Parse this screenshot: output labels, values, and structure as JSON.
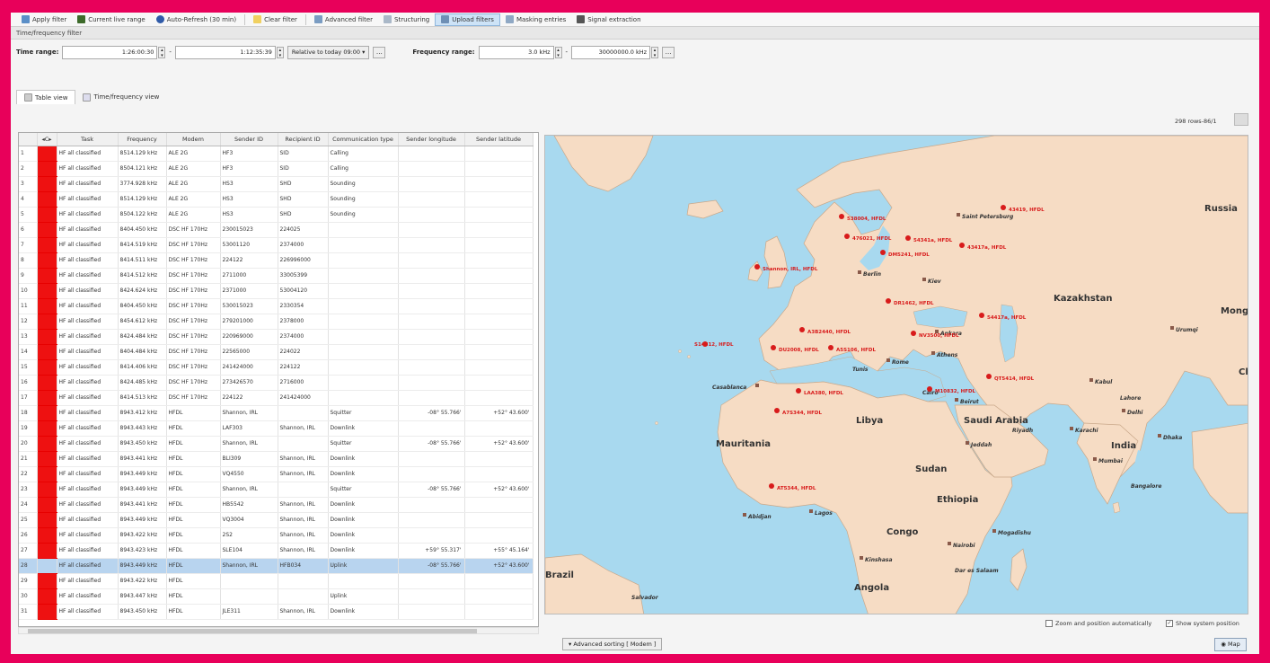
{
  "toolbar": {
    "buttons": [
      {
        "label": "Apply filter",
        "color": "#5b8fc7"
      },
      {
        "label": "Current live range",
        "color": "#3d6a2a"
      },
      {
        "label": "Auto-Refresh (30 min)",
        "color": "#2f5aa8"
      },
      {
        "label": "Clear filter",
        "color": "#f0d060"
      },
      {
        "label": "Advanced filter",
        "color": "#7a9cc2"
      },
      {
        "label": "Structuring",
        "color": "#aab8c8"
      },
      {
        "label": "Upload filters",
        "color": "#6e8fb5"
      },
      {
        "label": "Masking entries",
        "color": "#8fa8c4"
      },
      {
        "label": "Signal extraction",
        "color": "#555"
      }
    ]
  },
  "section_title": "Time/frequency filter",
  "filters": {
    "time_label": "Time range:",
    "time_from": "1:26:00:30",
    "time_to": "1:12:35:39",
    "time_relative": "Relative to today 09:00",
    "freq_label": "Frequency range:",
    "freq_from": "3.0 kHz",
    "freq_to": "30000000.0 kHz"
  },
  "tabs": [
    "Table view",
    "Time/frequency view"
  ],
  "row_count": "298 rows-86/1",
  "columns": [
    "Task",
    "Frequency",
    "Modem",
    "Sender ID",
    "Recipient ID",
    "Communication type",
    "Sender longitude",
    "Sender latitude"
  ],
  "rows": [
    {
      "n": "1",
      "task": "HF all classified",
      "freq": "8514.129 kHz",
      "modem": "ALE 2G",
      "sender": "HF3",
      "recipient": "SID",
      "comm": "Calling",
      "lon": "",
      "lat": ""
    },
    {
      "n": "2",
      "task": "HF all classified",
      "freq": "8504.121 kHz",
      "modem": "ALE 2G",
      "sender": "HF3",
      "recipient": "SID",
      "comm": "Calling",
      "lon": "",
      "lat": ""
    },
    {
      "n": "3",
      "task": "HF all classified",
      "freq": "3774.928 kHz",
      "modem": "ALE 2G",
      "sender": "HS3",
      "recipient": "SHD",
      "comm": "Sounding",
      "lon": "",
      "lat": ""
    },
    {
      "n": "4",
      "task": "HF all classified",
      "freq": "8514.129 kHz",
      "modem": "ALE 2G",
      "sender": "HS3",
      "recipient": "SHD",
      "comm": "Sounding",
      "lon": "",
      "lat": ""
    },
    {
      "n": "5",
      "task": "HF all classified",
      "freq": "8504.122 kHz",
      "modem": "ALE 2G",
      "sender": "HS3",
      "recipient": "SHD",
      "comm": "Sounding",
      "lon": "",
      "lat": ""
    },
    {
      "n": "6",
      "task": "HF all classified",
      "freq": "8404.450 kHz",
      "modem": "DSC HF 170Hz",
      "sender": "230015023",
      "recipient": "224025",
      "comm": "",
      "lon": "",
      "lat": ""
    },
    {
      "n": "7",
      "task": "HF all classified",
      "freq": "8414.519 kHz",
      "modem": "DSC HF 170Hz",
      "sender": "53001120",
      "recipient": "2374000",
      "comm": "",
      "lon": "",
      "lat": ""
    },
    {
      "n": "8",
      "task": "HF all classified",
      "freq": "8414.511 kHz",
      "modem": "DSC HF 170Hz",
      "sender": "224122",
      "recipient": "226996000",
      "comm": "",
      "lon": "",
      "lat": ""
    },
    {
      "n": "9",
      "task": "HF all classified",
      "freq": "8414.512 kHz",
      "modem": "DSC HF 170Hz",
      "sender": "2711000",
      "recipient": "33005399",
      "comm": "",
      "lon": "",
      "lat": ""
    },
    {
      "n": "10",
      "task": "HF all classified",
      "freq": "8424.624 kHz",
      "modem": "DSC HF 170Hz",
      "sender": "2371000",
      "recipient": "53004120",
      "comm": "",
      "lon": "",
      "lat": ""
    },
    {
      "n": "11",
      "task": "HF all classified",
      "freq": "8404.450 kHz",
      "modem": "DSC HF 170Hz",
      "sender": "530015023",
      "recipient": "2330354",
      "comm": "",
      "lon": "",
      "lat": ""
    },
    {
      "n": "12",
      "task": "HF all classified",
      "freq": "8454.612 kHz",
      "modem": "DSC HF 170Hz",
      "sender": "279201000",
      "recipient": "2378000",
      "comm": "",
      "lon": "",
      "lat": ""
    },
    {
      "n": "13",
      "task": "HF all classified",
      "freq": "8424.484 kHz",
      "modem": "DSC HF 170Hz",
      "sender": "220969000",
      "recipient": "2374000",
      "comm": "",
      "lon": "",
      "lat": ""
    },
    {
      "n": "14",
      "task": "HF all classified",
      "freq": "8404.484 kHz",
      "modem": "DSC HF 170Hz",
      "sender": "22565000",
      "recipient": "224022",
      "comm": "",
      "lon": "",
      "lat": ""
    },
    {
      "n": "15",
      "task": "HF all classified",
      "freq": "8414.406 kHz",
      "modem": "DSC HF 170Hz",
      "sender": "241424000",
      "recipient": "224122",
      "comm": "",
      "lon": "",
      "lat": ""
    },
    {
      "n": "16",
      "task": "HF all classified",
      "freq": "8424.485 kHz",
      "modem": "DSC HF 170Hz",
      "sender": "273426570",
      "recipient": "2716000",
      "comm": "",
      "lon": "",
      "lat": ""
    },
    {
      "n": "17",
      "task": "HF all classified",
      "freq": "8414.513 kHz",
      "modem": "DSC HF 170Hz",
      "sender": "224122",
      "recipient": "241424000",
      "comm": "",
      "lon": "",
      "lat": ""
    },
    {
      "n": "18",
      "task": "HF all classified",
      "freq": "8943.412 kHz",
      "modem": "HFDL",
      "sender": "Shannon, IRL",
      "recipient": "",
      "comm": "Squitter",
      "lon": "-08° 55.766'",
      "lat": "+52° 43.600'"
    },
    {
      "n": "19",
      "task": "HF all classified",
      "freq": "8943.443 kHz",
      "modem": "HFDL",
      "sender": "LAF303",
      "recipient": "Shannon, IRL",
      "comm": "Downlink",
      "lon": "",
      "lat": ""
    },
    {
      "n": "20",
      "task": "HF all classified",
      "freq": "8943.450 kHz",
      "modem": "HFDL",
      "sender": "Shannon, IRL",
      "recipient": "",
      "comm": "Squitter",
      "lon": "-08° 55.766'",
      "lat": "+52° 43.600'"
    },
    {
      "n": "21",
      "task": "HF all classified",
      "freq": "8943.441 kHz",
      "modem": "HFDL",
      "sender": "BLI309",
      "recipient": "Shannon, IRL",
      "comm": "Downlink",
      "lon": "",
      "lat": ""
    },
    {
      "n": "22",
      "task": "HF all classified",
      "freq": "8943.449 kHz",
      "modem": "HFDL",
      "sender": "VQ4550",
      "recipient": "Shannon, IRL",
      "comm": "Downlink",
      "lon": "",
      "lat": ""
    },
    {
      "n": "23",
      "task": "HF all classified",
      "freq": "8943.449 kHz",
      "modem": "HFDL",
      "sender": "Shannon, IRL",
      "recipient": "",
      "comm": "Squitter",
      "lon": "-08° 55.766'",
      "lat": "+52° 43.600'"
    },
    {
      "n": "24",
      "task": "HF all classified",
      "freq": "8943.441 kHz",
      "modem": "HFDL",
      "sender": "HB5542",
      "recipient": "Shannon, IRL",
      "comm": "Downlink",
      "lon": "",
      "lat": ""
    },
    {
      "n": "25",
      "task": "HF all classified",
      "freq": "8943.449 kHz",
      "modem": "HFDL",
      "sender": "VQ3004",
      "recipient": "Shannon, IRL",
      "comm": "Downlink",
      "lon": "",
      "lat": ""
    },
    {
      "n": "26",
      "task": "HF all classified",
      "freq": "8943.422 kHz",
      "modem": "HFDL",
      "sender": "2S2",
      "recipient": "Shannon, IRL",
      "comm": "Downlink",
      "lon": "",
      "lat": ""
    },
    {
      "n": "27",
      "task": "HF all classified",
      "freq": "8943.423 kHz",
      "modem": "HFDL",
      "sender": "SLE104",
      "recipient": "Shannon, IRL",
      "comm": "Downlink",
      "lon": "+59° 55.317'",
      "lat": "+55° 45.164'"
    },
    {
      "n": "28",
      "task": "HF all classified",
      "freq": "8943.449 kHz",
      "modem": "HFDL",
      "sender": "Shannon, IRL",
      "recipient": "HFB034",
      "comm": "Uplink",
      "lon": "-08° 55.766'",
      "lat": "+52° 43.600'",
      "selected": true
    },
    {
      "n": "29",
      "task": "HF all classified",
      "freq": "8943.422 kHz",
      "modem": "HFDL",
      "sender": "",
      "recipient": "",
      "comm": "",
      "lon": "",
      "lat": ""
    },
    {
      "n": "30",
      "task": "HF all classified",
      "freq": "8943.447 kHz",
      "modem": "HFDL",
      "sender": "",
      "recipient": "",
      "comm": "Uplink",
      "lon": "",
      "lat": ""
    },
    {
      "n": "31",
      "task": "HF all classified",
      "freq": "8943.450 kHz",
      "modem": "HFDL",
      "sender": "JLE311",
      "recipient": "Shannon, IRL",
      "comm": "Downlink",
      "lon": "",
      "lat": ""
    }
  ],
  "map": {
    "countries": [
      "Russia",
      "Kazakhstan",
      "Mong",
      "Chi",
      "India",
      "Libya",
      "Saudi Arabia",
      "Mauritania",
      "Sudan",
      "Ethiopia",
      "Congo",
      "Angola",
      "Brazil"
    ],
    "cities": [
      "Saint Petersburg",
      "Berlin",
      "Kiev",
      "Ankara",
      "Athens",
      "Rome",
      "Casablanca",
      "Beirut",
      "Jeddah",
      "Lagos",
      "Abidjan",
      "Kinshasa",
      "Nairobi",
      "Dar es Salaam",
      "Mogadishu",
      "Mumbai",
      "Karachi",
      "Delhi",
      "Kabul",
      "Lahore",
      "Dhaka",
      "Bangalore",
      "Salvador",
      "Urumqi",
      "Tunis",
      "Cairo",
      "Riyadh"
    ],
    "markers": [
      "Shannon, IRL, HFDL",
      "538004, HFDL",
      "43419, HFDL",
      "476021, HFDL",
      "54341a, HFDL",
      "DM5241, HFDL",
      "DR1462, HFDL",
      "43417a, HFDL",
      "A3B2440, HFDL",
      "54417a, HFDL",
      "NV3500, HFDL",
      "DU2008, HFDL",
      "S14812, HFDL",
      "A5S106, HFDL",
      "LAA380, HFDL",
      "M10832, HFDL",
      "QT5414, HFDL",
      "A7S344, HFDL",
      "AT5344, HFDL"
    ],
    "zoom_option": "Zoom and position automatically",
    "system_option": "Show system position",
    "map_button": "Map"
  },
  "advanced_sorting": "Advanced sorting [ Modem ]",
  "colors": {
    "row_class": "#ee1111",
    "sea": "#a8d9ef",
    "land": "#f6dcc4",
    "marker": "#d81b1b",
    "accent": "#e8005a"
  }
}
